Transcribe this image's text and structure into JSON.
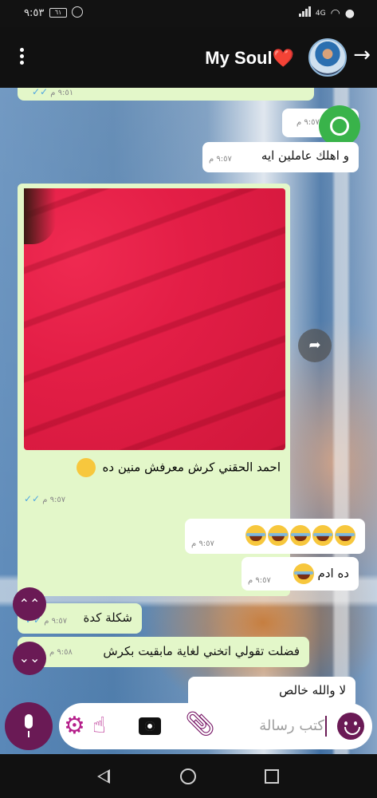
{
  "status_bar": {
    "time": "٩:٥٣",
    "battery": "٦١",
    "network": "4G"
  },
  "header": {
    "contact_name": "My Soul❤️",
    "back_icon": "arrow-right-icon",
    "menu_icon": "vertical-dots-icon"
  },
  "messages": [
    {
      "id": "m0",
      "type": "out",
      "text": "",
      "time": "٩:٥١ م"
    },
    {
      "id": "m1",
      "type": "in",
      "text": "",
      "time": "٩:٥٧ م"
    },
    {
      "id": "m2",
      "type": "in",
      "text": "و اهلك عاملين ايه",
      "time": "٩:٥٧ م"
    },
    {
      "id": "m3",
      "type": "out-image",
      "caption": "احمد الحقني كرش معرفش منين ده",
      "time": "٩:٥٧ م"
    },
    {
      "id": "m4",
      "type": "in",
      "text": "😂😂😂😂😂",
      "time": "٩:٥٧ م"
    },
    {
      "id": "m5",
      "type": "in",
      "text": "ده ادم 😂",
      "time": "٩:٥٧ م"
    },
    {
      "id": "m6",
      "type": "out",
      "text": "شكلة كدة",
      "time": "٩:٥٧ م"
    },
    {
      "id": "m7",
      "type": "out",
      "text": "فضلت تقولي اتخني لغاية مابقيت بكرش",
      "time": "٩:٥٨ م"
    },
    {
      "id": "m8",
      "type": "in",
      "text": "لا والله خالص",
      "time": ""
    }
  ],
  "composer": {
    "placeholder": "كتب رسالة",
    "icons": [
      "mic-icon",
      "gear-icon",
      "touch-icon",
      "camera-icon",
      "paperclip-icon",
      "smiley-icon"
    ]
  },
  "colors": {
    "accent": "#6a1a55",
    "out_bubble": "#e3f7c9",
    "in_bubble": "#ffffff"
  }
}
